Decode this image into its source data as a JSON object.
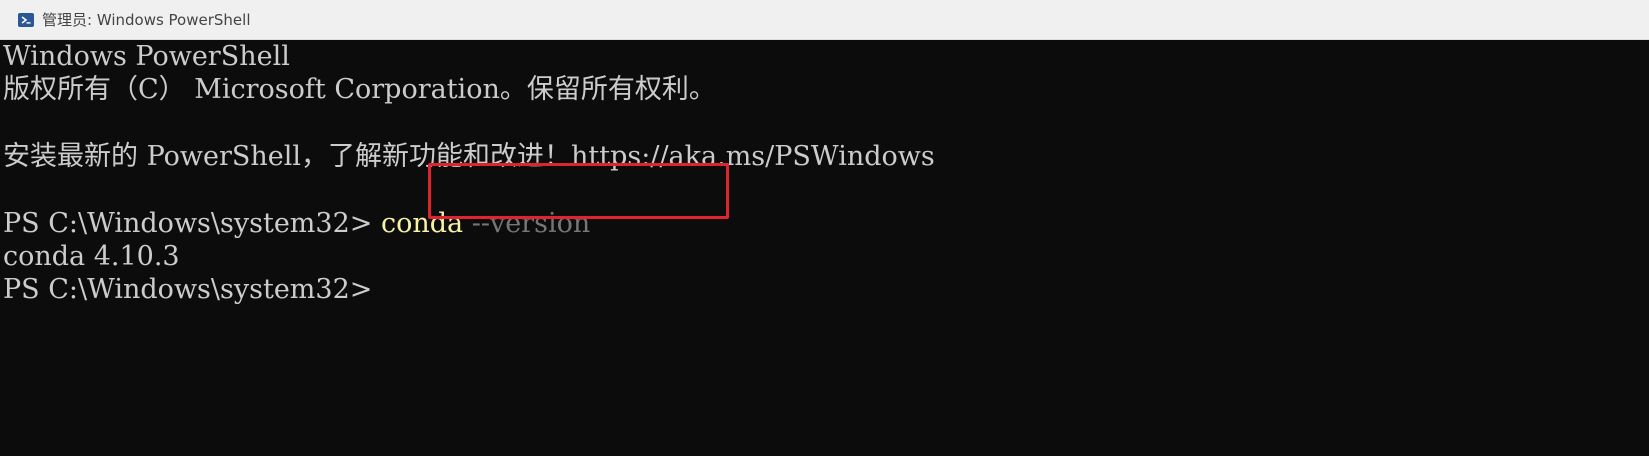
{
  "window": {
    "title": "管理员: Windows PowerShell",
    "icon": "powershell-icon",
    "accent_color": "#2b5797"
  },
  "console": {
    "line1": "Windows PowerShell",
    "line2": "版权所有（C） Microsoft Corporation。保留所有权利。",
    "line3": "安装最新的 PowerShell，了解新功能和改进！https://aka.ms/PSWindows",
    "prompt1": "PS C:\\Windows\\system32> ",
    "command": "conda",
    "command_param": " --version",
    "output": "conda 4.10.3",
    "prompt2": "PS C:\\Windows\\system32>"
  },
  "colors": {
    "background": "#0c0c0c",
    "foreground": "#cccccc",
    "command": "#f9f1a5",
    "parameter": "#767676",
    "highlight_box": "#e0242f"
  }
}
